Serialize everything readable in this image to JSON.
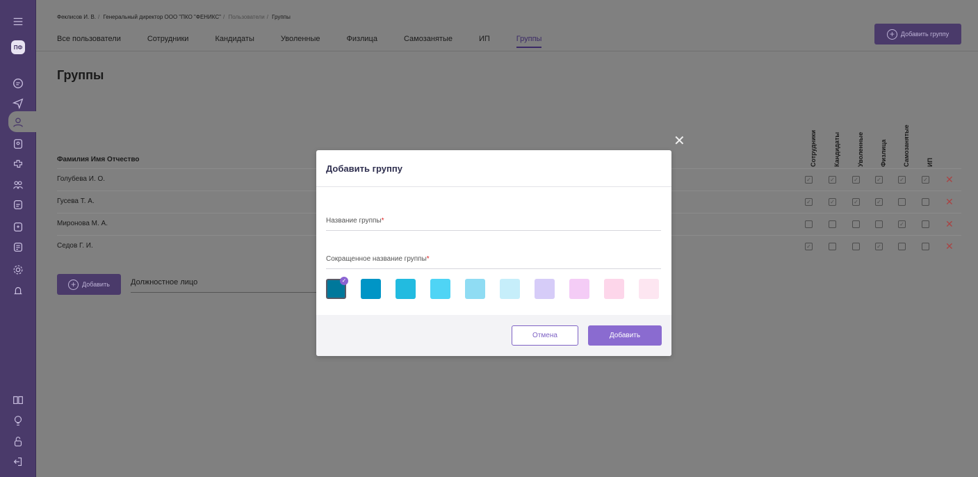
{
  "sidebar": {
    "logo": "ПФ",
    "icons": [
      "menu-icon",
      "document-icon",
      "send-icon",
      "user-icon",
      "badge-icon",
      "puzzle-icon",
      "users-icon",
      "calendar-icon",
      "add-user-icon",
      "list-icon",
      "settings-icon",
      "bell-icon",
      "book-icon",
      "lightbulb-icon",
      "unlock-icon",
      "logout-icon"
    ]
  },
  "breadcrumb": {
    "user": "Феклисов И. В.",
    "company": "Генеральный директор ООО \"ПКО \"ФЕНИКС\"",
    "section": "Пользователи",
    "current": "Группы"
  },
  "tabs": [
    "Все пользователи",
    "Сотрудники",
    "Кандидаты",
    "Уволенные",
    "Физлица",
    "Самозанятые",
    "ИП",
    "Группы"
  ],
  "active_tab": "Группы",
  "header": {
    "add_group_label": "Добавить группу"
  },
  "page_title": "Группы",
  "table": {
    "name_header": "Фамилия Имя Отчество",
    "columns": [
      "Сотрудники",
      "Кандидаты",
      "Уволенные",
      "Физлица",
      "Самозанятые",
      "ИП"
    ],
    "rows": [
      {
        "name": "Голубева И. О.",
        "checks": [
          true,
          true,
          true,
          true,
          true,
          true
        ]
      },
      {
        "name": "Гусева Т. А.",
        "checks": [
          true,
          true,
          true,
          true,
          false,
          false
        ]
      },
      {
        "name": "Миронова М. А.",
        "checks": [
          false,
          false,
          false,
          false,
          true,
          false
        ]
      },
      {
        "name": "Седов Г. И.",
        "checks": [
          true,
          false,
          false,
          true,
          false,
          false
        ]
      }
    ]
  },
  "form": {
    "add_label": "Добавить",
    "position_placeholder": "Должностное лицо"
  },
  "modal": {
    "title": "Добавить группу",
    "group_name_label": "Название группы",
    "short_name_label": "Сокращенное название группы",
    "required_mark": "*",
    "colors": [
      "#00789b",
      "#0095c6",
      "#22bbe0",
      "#4fd4f5",
      "#8fdcf3",
      "#c6eefa",
      "#d6ccf8",
      "#f4ccf6",
      "#fdd6ea",
      "#fde6f1"
    ],
    "selected_color_index": 0,
    "cancel_label": "Отмена",
    "submit_label": "Добавить",
    "close_icon": "close-icon"
  }
}
